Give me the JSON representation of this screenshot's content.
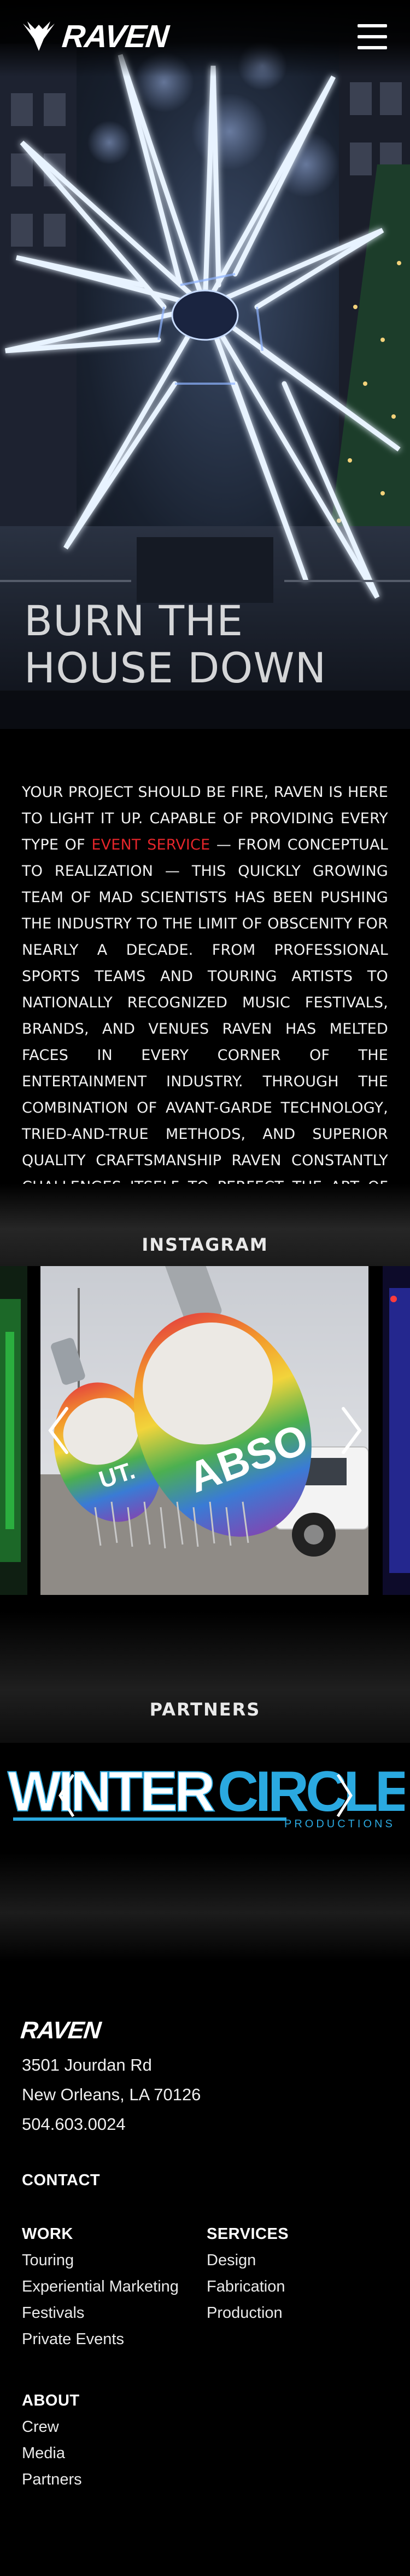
{
  "brand": {
    "name": "RAVEN"
  },
  "hero": {
    "title_line1": "BURN THE",
    "title_line2": "HOUSE DOWN"
  },
  "intro": {
    "part1": "YOUR PROJECT SHOULD BE FIRE, RAVEN IS HERE TO LIGHT IT UP. CAPABLE OF PROVIDING EVERY TYPE OF ",
    "link": "EVENT SERVICE",
    "part2": " — FROM CONCEPTUAL TO REALIZATION — THIS QUICKLY GROWING TEAM OF MAD SCIENTISTS HAS BEEN PUSHING THE INDUSTRY TO THE LIMIT OF OBSCENITY FOR NEARLY A DECADE. FROM PROFESSIONAL SPORTS TEAMS AND TOURING ARTISTS TO NATIONALLY RECOGNIZED MUSIC FESTIVALS, BRANDS, AND VENUES RAVEN HAS MELTED FACES IN EVERY CORNER OF THE ENTERTAINMENT INDUSTRY. THROUGH THE COMBINATION OF AVANT-GARDE TECHNOLOGY, TRIED-AND-TRUE METHODS, AND SUPERIOR QUALITY CRAFTSMANSHIP RAVEN CONSTANTLY CHALLENGES ITSELF TO PERFECT THE ART OF BLOWING MINDS."
  },
  "instagram": {
    "heading": "INSTAGRAM",
    "inflatable_text_1": "ABSO",
    "inflatable_text_2": "UT."
  },
  "partners": {
    "heading": "PARTNERS",
    "logo_word1": "WINTER",
    "logo_word2": "CIRCLE",
    "logo_sub": "PRODUCTIONS"
  },
  "footer": {
    "logo": "RAVEN",
    "address_line1": "3501 Jourdan Rd",
    "address_line2": "New Orleans, LA 70126",
    "phone": "504.603.0024",
    "contact": "CONTACT",
    "work_heading": "WORK",
    "work_items": [
      "Touring",
      "Experiential Marketing",
      "Festivals",
      "Private Events"
    ],
    "services_heading": "SERVICES",
    "services_items": [
      "Design",
      "Fabrication",
      "Production"
    ],
    "about_heading": "ABOUT",
    "about_items": [
      "Crew",
      "Media",
      "Partners"
    ]
  },
  "colors": {
    "accent": "#e4252a",
    "partner_blue": "#2aa9e0",
    "background": "#000000"
  },
  "icons": {
    "menu": "hamburger-icon",
    "prev": "chevron-left-icon",
    "next": "chevron-right-icon",
    "brand": "raven-bird-icon"
  }
}
